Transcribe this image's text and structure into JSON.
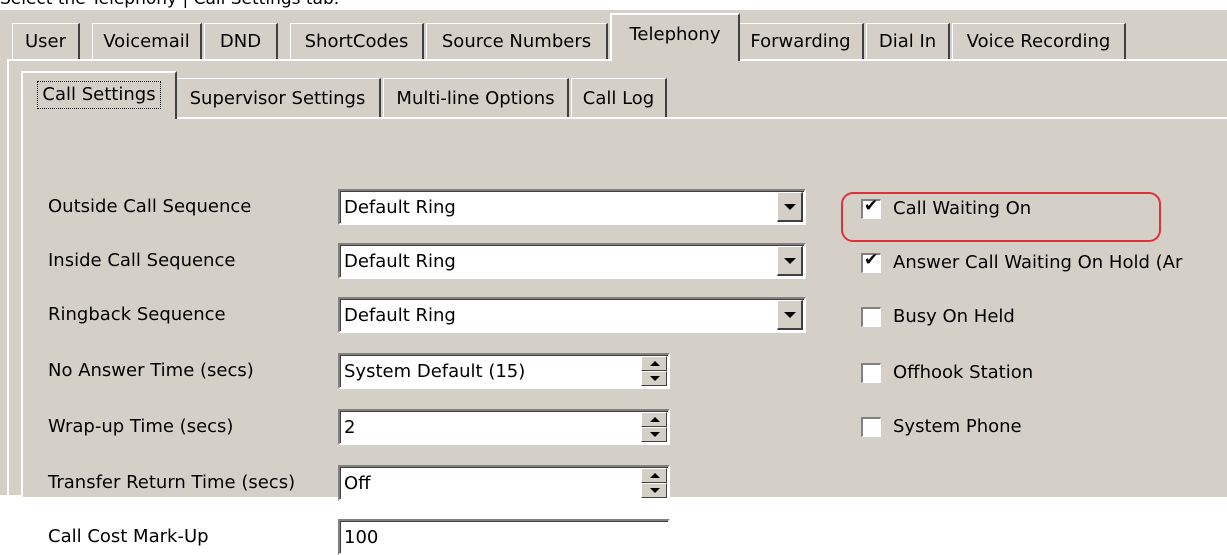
{
  "caption": "Select the Telephony | Call Settings tab.",
  "top_tabs": [
    "User",
    "Voicemail",
    "DND",
    "ShortCodes",
    "Source Numbers",
    "Telephony",
    "Forwarding",
    "Dial In",
    "Voice Recording"
  ],
  "active_top_tab": "Telephony",
  "sub_tabs": [
    "Call Settings",
    "Supervisor Settings",
    "Multi-line Options",
    "Call Log"
  ],
  "active_sub_tab": "Call Settings",
  "fields": [
    {
      "label": "Outside Call Sequence",
      "value": "Default Ring",
      "kind": "dropdown"
    },
    {
      "label": "Inside Call Sequence",
      "value": "Default Ring",
      "kind": "dropdown"
    },
    {
      "label": "Ringback Sequence",
      "value": "Default Ring",
      "kind": "dropdown"
    },
    {
      "label": "No Answer Time (secs)",
      "value": "System Default (15)",
      "kind": "spinner"
    },
    {
      "label": "Wrap-up Time (secs)",
      "value": "2",
      "kind": "spinner"
    },
    {
      "label": "Transfer Return Time (secs)",
      "value": "Off",
      "kind": "spinner"
    },
    {
      "label": "Call Cost Mark-Up",
      "value": "100",
      "kind": "text"
    }
  ],
  "checkboxes": [
    {
      "label": "Call Waiting On",
      "checked": true
    },
    {
      "label": "Answer Call Waiting On Hold (Ar",
      "checked": true
    },
    {
      "label": "Busy On Held",
      "checked": false
    },
    {
      "label": "Offhook Station",
      "checked": false
    },
    {
      "label": "System Phone",
      "checked": false
    }
  ],
  "highlight_color": "#e0303a",
  "window_color": "#d4d0c8"
}
